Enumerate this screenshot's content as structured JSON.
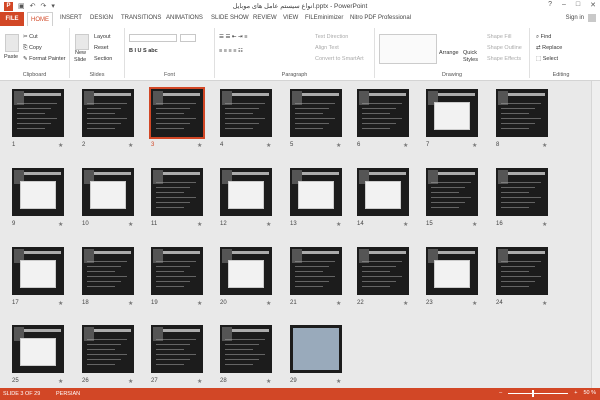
{
  "title": "انواع سیستم عامل های موبایل.pptx - PowerPoint",
  "qat": {
    "logo": "P",
    "save": "▣",
    "undo": "↶",
    "redo": "↷",
    "more": "▾"
  },
  "window": {
    "help": "?",
    "min": "–",
    "max": "□",
    "close": "✕"
  },
  "tabs": [
    "FILE",
    "HOME",
    "INSERT",
    "DESIGN",
    "TRANSITIONS",
    "ANIMATIONS",
    "SLIDE SHOW",
    "REVIEW",
    "VIEW",
    "FILEminimizer",
    "Nitro PDF Professional"
  ],
  "active_tab": "HOME",
  "signin": "Sign in",
  "ribbon": {
    "clipboard": {
      "label": "Clipboard",
      "paste": "Paste",
      "cut": "Cut",
      "copy": "Copy",
      "painter": "Format Painter"
    },
    "slides": {
      "label": "Slides",
      "new": "New",
      "slide": "Slide",
      "layout": "Layout",
      "reset": "Reset",
      "section": "Section"
    },
    "font": {
      "label": "Font"
    },
    "paragraph": {
      "label": "Paragraph",
      "text_direction": "Text Direction",
      "align_text": "Align Text",
      "smartart": "Convert to SmartArt"
    },
    "drawing": {
      "label": "Drawing",
      "arrange": "Arrange",
      "quick": "Quick",
      "styles": "Styles",
      "fill": "Shape Fill",
      "outline": "Shape Outline",
      "effects": "Shape Effects"
    },
    "editing": {
      "label": "Editing",
      "find": "Find",
      "replace": "Replace",
      "select": "Select"
    }
  },
  "slides": [
    "1",
    "2",
    "3",
    "4",
    "5",
    "6",
    "7",
    "8",
    "9",
    "10",
    "11",
    "12",
    "13",
    "14",
    "15",
    "16",
    "17",
    "18",
    "19",
    "20",
    "21",
    "22",
    "23",
    "24",
    "25",
    "26",
    "27",
    "28",
    "29"
  ],
  "selected_slide": "3",
  "star": "★",
  "status": {
    "slide_info": "SLIDE 3 OF 29",
    "language": "PERSIAN",
    "zoom": "50 %",
    "minus": "–",
    "plus": "+"
  },
  "colors": {
    "accent": "#d24726",
    "slide_bg": "#1c1c1c"
  }
}
